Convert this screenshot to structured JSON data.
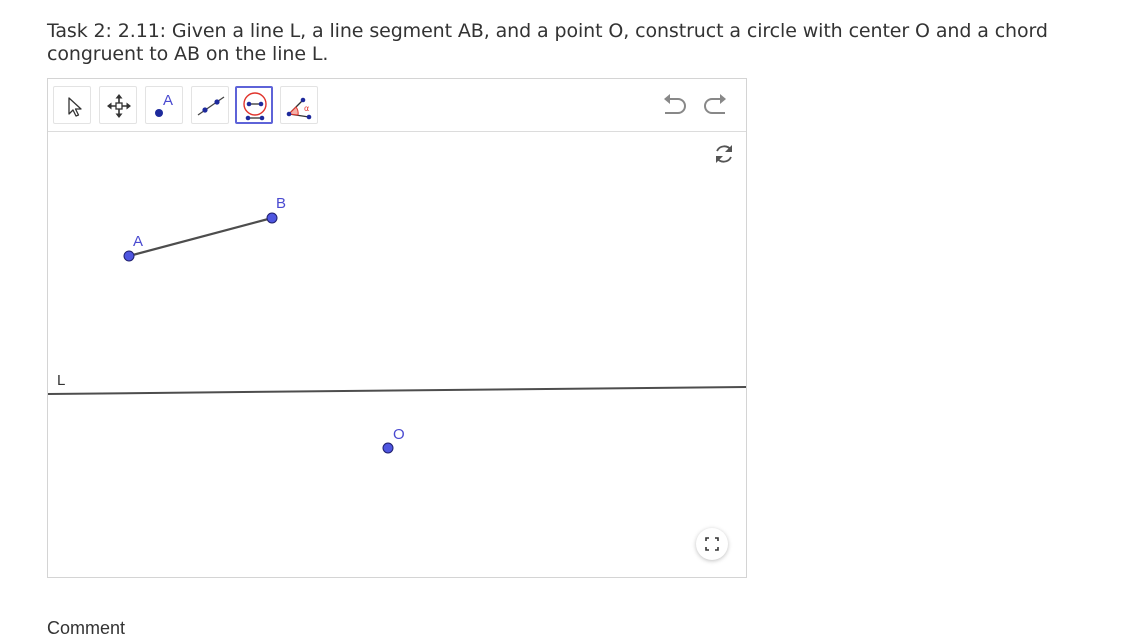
{
  "task": {
    "text": "Task 2: 2.11: Given a line L, a line segment AB, and a point O, construct a circle with center O and a chord congruent to AB on the line L."
  },
  "toolbar": {
    "tools": [
      {
        "name": "move-tool",
        "icon": "cursor-arrow-icon"
      },
      {
        "name": "move-graphics-view-tool",
        "icon": "move-cross-icon"
      },
      {
        "name": "point-tool",
        "icon": "point-icon",
        "label": "A"
      },
      {
        "name": "line-tool",
        "icon": "line-through-points-icon"
      },
      {
        "name": "compass-tool",
        "icon": "compass-circle-icon",
        "active": true
      },
      {
        "name": "angle-tool",
        "icon": "angle-icon"
      }
    ],
    "undo_icon": "undo-icon",
    "redo_icon": "redo-icon"
  },
  "graphics": {
    "refresh_icon": "refresh-icon",
    "fullscreen_icon": "fullscreen-icon",
    "points": {
      "A": "A",
      "B": "B",
      "O": "O"
    },
    "line_label": "L",
    "colors": {
      "point_fill": "#4f56e0",
      "point_label": "#4a4ad0",
      "line": "#4d4d4d",
      "active_tool_border": "#5e63d8"
    }
  },
  "comment_label": "Comment"
}
